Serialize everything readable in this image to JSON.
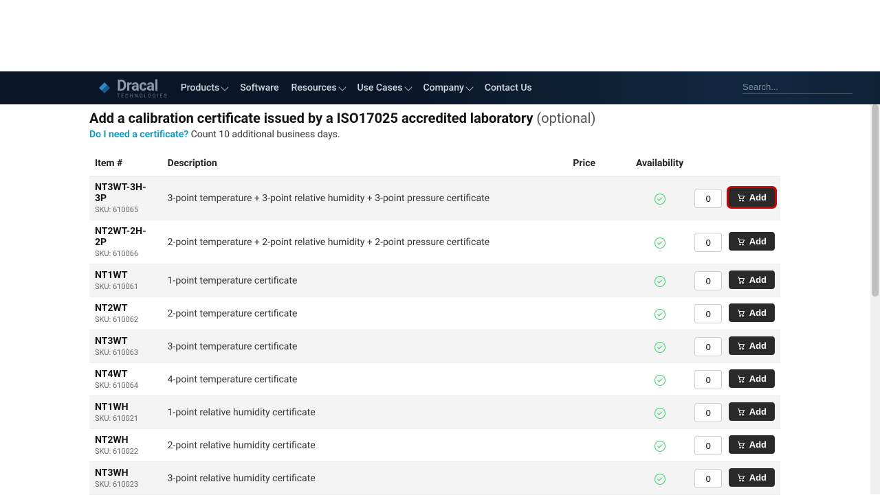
{
  "brand": {
    "name": "Dracal",
    "tagline": "TECHNOLOGIES"
  },
  "nav": {
    "items": [
      {
        "label": "Products",
        "dropdown": true
      },
      {
        "label": "Software",
        "dropdown": false
      },
      {
        "label": "Resources",
        "dropdown": true
      },
      {
        "label": "Use Cases",
        "dropdown": true
      },
      {
        "label": "Company",
        "dropdown": true
      },
      {
        "label": "Contact Us",
        "dropdown": false
      }
    ]
  },
  "search": {
    "placeholder": "Search..."
  },
  "heading": {
    "title": "Add a calibration certificate issued by a ISO17025 accredited laboratory",
    "optional": "(optional)"
  },
  "subhead": {
    "link": "Do I need a certificate?",
    "note": "Count 10 additional business days."
  },
  "columns": {
    "item": "Item #",
    "description": "Description",
    "price": "Price",
    "availability": "Availability"
  },
  "add_label": "Add",
  "sku_prefix": "SKU:",
  "default_qty": "0",
  "rows": [
    {
      "code": "NT3WT-3H-3P",
      "sku": "610065",
      "desc": "3-point temperature + 3-point relative humidity + 3-point pressure certificate",
      "highlighted": true
    },
    {
      "code": "NT2WT-2H-2P",
      "sku": "610066",
      "desc": "2-point temperature + 2-point relative humidity + 2-point pressure certificate",
      "highlighted": false
    },
    {
      "code": "NT1WT",
      "sku": "610061",
      "desc": "1-point temperature certificate",
      "highlighted": false
    },
    {
      "code": "NT2WT",
      "sku": "610062",
      "desc": "2-point temperature certificate",
      "highlighted": false
    },
    {
      "code": "NT3WT",
      "sku": "610063",
      "desc": "3-point temperature certificate",
      "highlighted": false
    },
    {
      "code": "NT4WT",
      "sku": "610064",
      "desc": "4-point temperature certificate",
      "highlighted": false
    },
    {
      "code": "NT1WH",
      "sku": "610021",
      "desc": "1-point relative humidity certificate",
      "highlighted": false
    },
    {
      "code": "NT2WH",
      "sku": "610022",
      "desc": "2-point relative humidity certificate",
      "highlighted": false
    },
    {
      "code": "NT3WH",
      "sku": "610023",
      "desc": "3-point relative humidity certificate",
      "highlighted": false
    }
  ]
}
